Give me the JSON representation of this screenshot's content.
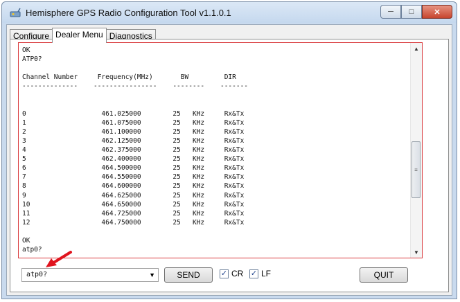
{
  "window": {
    "title": "Hemisphere GPS Radio Configuration Tool v1.1.0.1",
    "controls": [
      "─",
      "□",
      "✕"
    ]
  },
  "tabs": [
    {
      "label": "Configure",
      "active": false
    },
    {
      "label": "Dealer Menu",
      "active": true
    },
    {
      "label": "Diagnostics",
      "active": false
    }
  ],
  "console": {
    "lines": [
      "OK",
      "ATP0?",
      "",
      "Channel Number     Frequency(MHz)       BW         DIR",
      "--------------    ----------------    --------    -------",
      "",
      "",
      "0                   461.025000        25   KHz     Rx&Tx",
      "1                   461.075000        25   KHz     Rx&Tx",
      "2                   461.100000        25   KHz     Rx&Tx",
      "3                   462.125000        25   KHz     Rx&Tx",
      "4                   462.375000        25   KHz     Rx&Tx",
      "5                   462.400000        25   KHz     Rx&Tx",
      "6                   464.500000        25   KHz     Rx&Tx",
      "7                   464.550000        25   KHz     Rx&Tx",
      "8                   464.600000        25   KHz     Rx&Tx",
      "9                   464.625000        25   KHz     Rx&Tx",
      "10                  464.650000        25   KHz     Rx&Tx",
      "11                  464.725000        25   KHz     Rx&Tx",
      "12                  464.750000        25   KHz     Rx&Tx",
      "",
      "OK",
      "atp0?"
    ]
  },
  "command": {
    "value": "atp0?"
  },
  "buttons": {
    "send": "SEND",
    "quit": "QUIT"
  },
  "checkboxes": {
    "cr": {
      "label": "CR",
      "checked": true
    },
    "lf": {
      "label": "LF",
      "checked": true
    }
  },
  "colors": {
    "console_border": "#d9373a",
    "annotation_arrow": "#e0141e"
  }
}
